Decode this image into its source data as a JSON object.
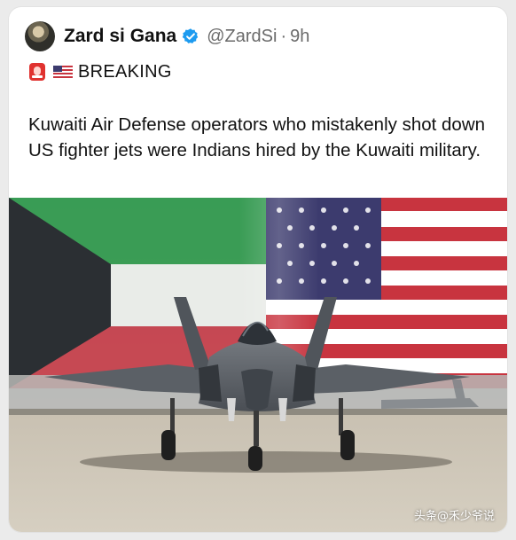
{
  "tweet": {
    "display_name": "Zard si Gana",
    "handle": "@ZardSi",
    "separator": "·",
    "time_ago": "9h",
    "verified_icon": "verified-badge-icon",
    "breaking_label": "BREAKING",
    "breaking_icons": [
      "siren-icon",
      "us-flag-icon"
    ],
    "body": "Kuwaiti Air Defense operators who mistakenly shot down US fighter jets were Indians hired by the Kuwaiti military."
  },
  "media": {
    "description_icon": "fighter-jet-image"
  },
  "watermark": {
    "text": "头条@禾少爷说"
  },
  "colors": {
    "verified_blue": "#1d9bf0",
    "kuwait_green": "#2f9a4a",
    "kuwait_red": "#c8343f",
    "us_blue": "#3c3b6e"
  }
}
